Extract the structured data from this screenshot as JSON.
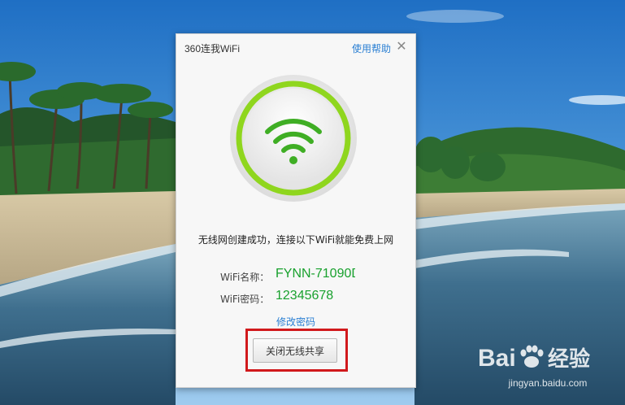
{
  "window": {
    "title": "360连我WiFi",
    "help_label": "使用帮助",
    "close_glyph": "✕"
  },
  "status_message": "无线网创建成功，连接以下WiFi就能免费上网",
  "wifi": {
    "name_label": "WiFi名称：",
    "name_value": "FYNN-71090D",
    "password_label": "WiFi密码：",
    "password_value": "12345678"
  },
  "change_password_label": "修改密码",
  "close_share_button_label": "关闭无线共享",
  "watermark": {
    "logo_text": "Bai经验",
    "url": "jingyan.baidu.com"
  },
  "colors": {
    "wifi_green": "#19a12e",
    "link_blue": "#2a7fd3",
    "highlight_red": "#d1191c"
  }
}
